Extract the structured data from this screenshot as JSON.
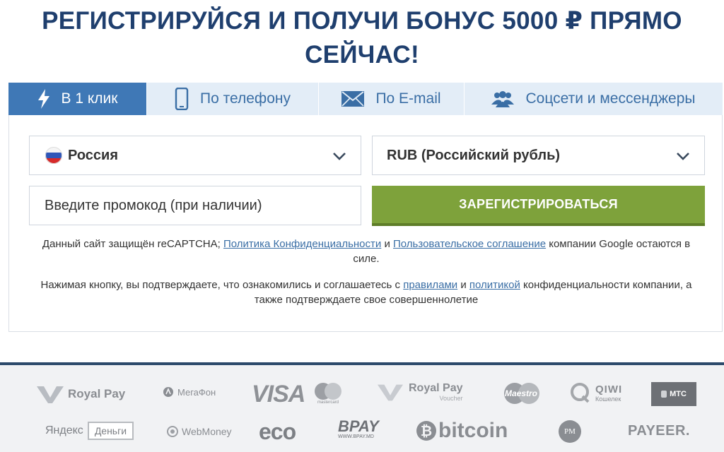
{
  "header": {
    "title_line1": "РЕГИСТРИРУЙСЯ И ПОЛУЧИ БОНУС 5000 ₽ ПРЯМО",
    "title_line2": "СЕЙЧАС!"
  },
  "tabs": [
    {
      "label": "В 1 клик",
      "icon": "lightning-icon",
      "active": true
    },
    {
      "label": "По телефону",
      "icon": "phone-icon",
      "active": false
    },
    {
      "label": "По E-mail",
      "icon": "envelope-icon",
      "active": false
    },
    {
      "label": "Соцсети и мессенджеры",
      "icon": "users-icon",
      "active": false
    }
  ],
  "form": {
    "country": "Россия",
    "currency": "RUB (Российский рубль)",
    "promo_placeholder": "Введите промокод (при наличии)",
    "register_label": "ЗАРЕГИСТРИРОВАТЬСЯ"
  },
  "notes": {
    "recaptcha_prefix": "Данный сайт защищён reCAPTCHA;",
    "privacy_link": "Политика Конфиденциальности",
    "and1": "и",
    "terms_link": "Пользовательское соглашение",
    "recaptcha_suffix": "компании Google остаются в силе.",
    "consent_prefix": "Нажимая кнопку, вы подтверждаете, что ознакомились и соглашаетесь с",
    "rules_link": "правилами",
    "and2": "и",
    "policy_link": "политикой",
    "consent_suffix": "конфиденциальности компании, а также подтверждаете свое совершеннолетие"
  },
  "payments": {
    "royal_pay": "Royal Pay",
    "megafon": "МегаФон",
    "visa": "VISA",
    "mastercard": "mastercard",
    "royal_pay_voucher": "Royal Pay",
    "voucher": "Voucher",
    "maestro": "Maestro",
    "qiwi": "QIWI",
    "qiwi_sub": "Кошелек",
    "mts": "МТС",
    "yandex": "Яндекс",
    "dengi": "Деньги",
    "webmoney": "WebMoney",
    "eco": "eco",
    "bpay": "BPAY",
    "bpay_url": "WWW.BPAY.MD",
    "bitcoin": "bitcoin",
    "pm": "PM",
    "payeer": "PAYEER."
  },
  "colors": {
    "brand_blue": "#1f3f6e",
    "tab_active": "#3f78b6",
    "tab_inactive": "#e3edf7",
    "register_green": "#7ea23b",
    "link": "#3a6ea5"
  }
}
